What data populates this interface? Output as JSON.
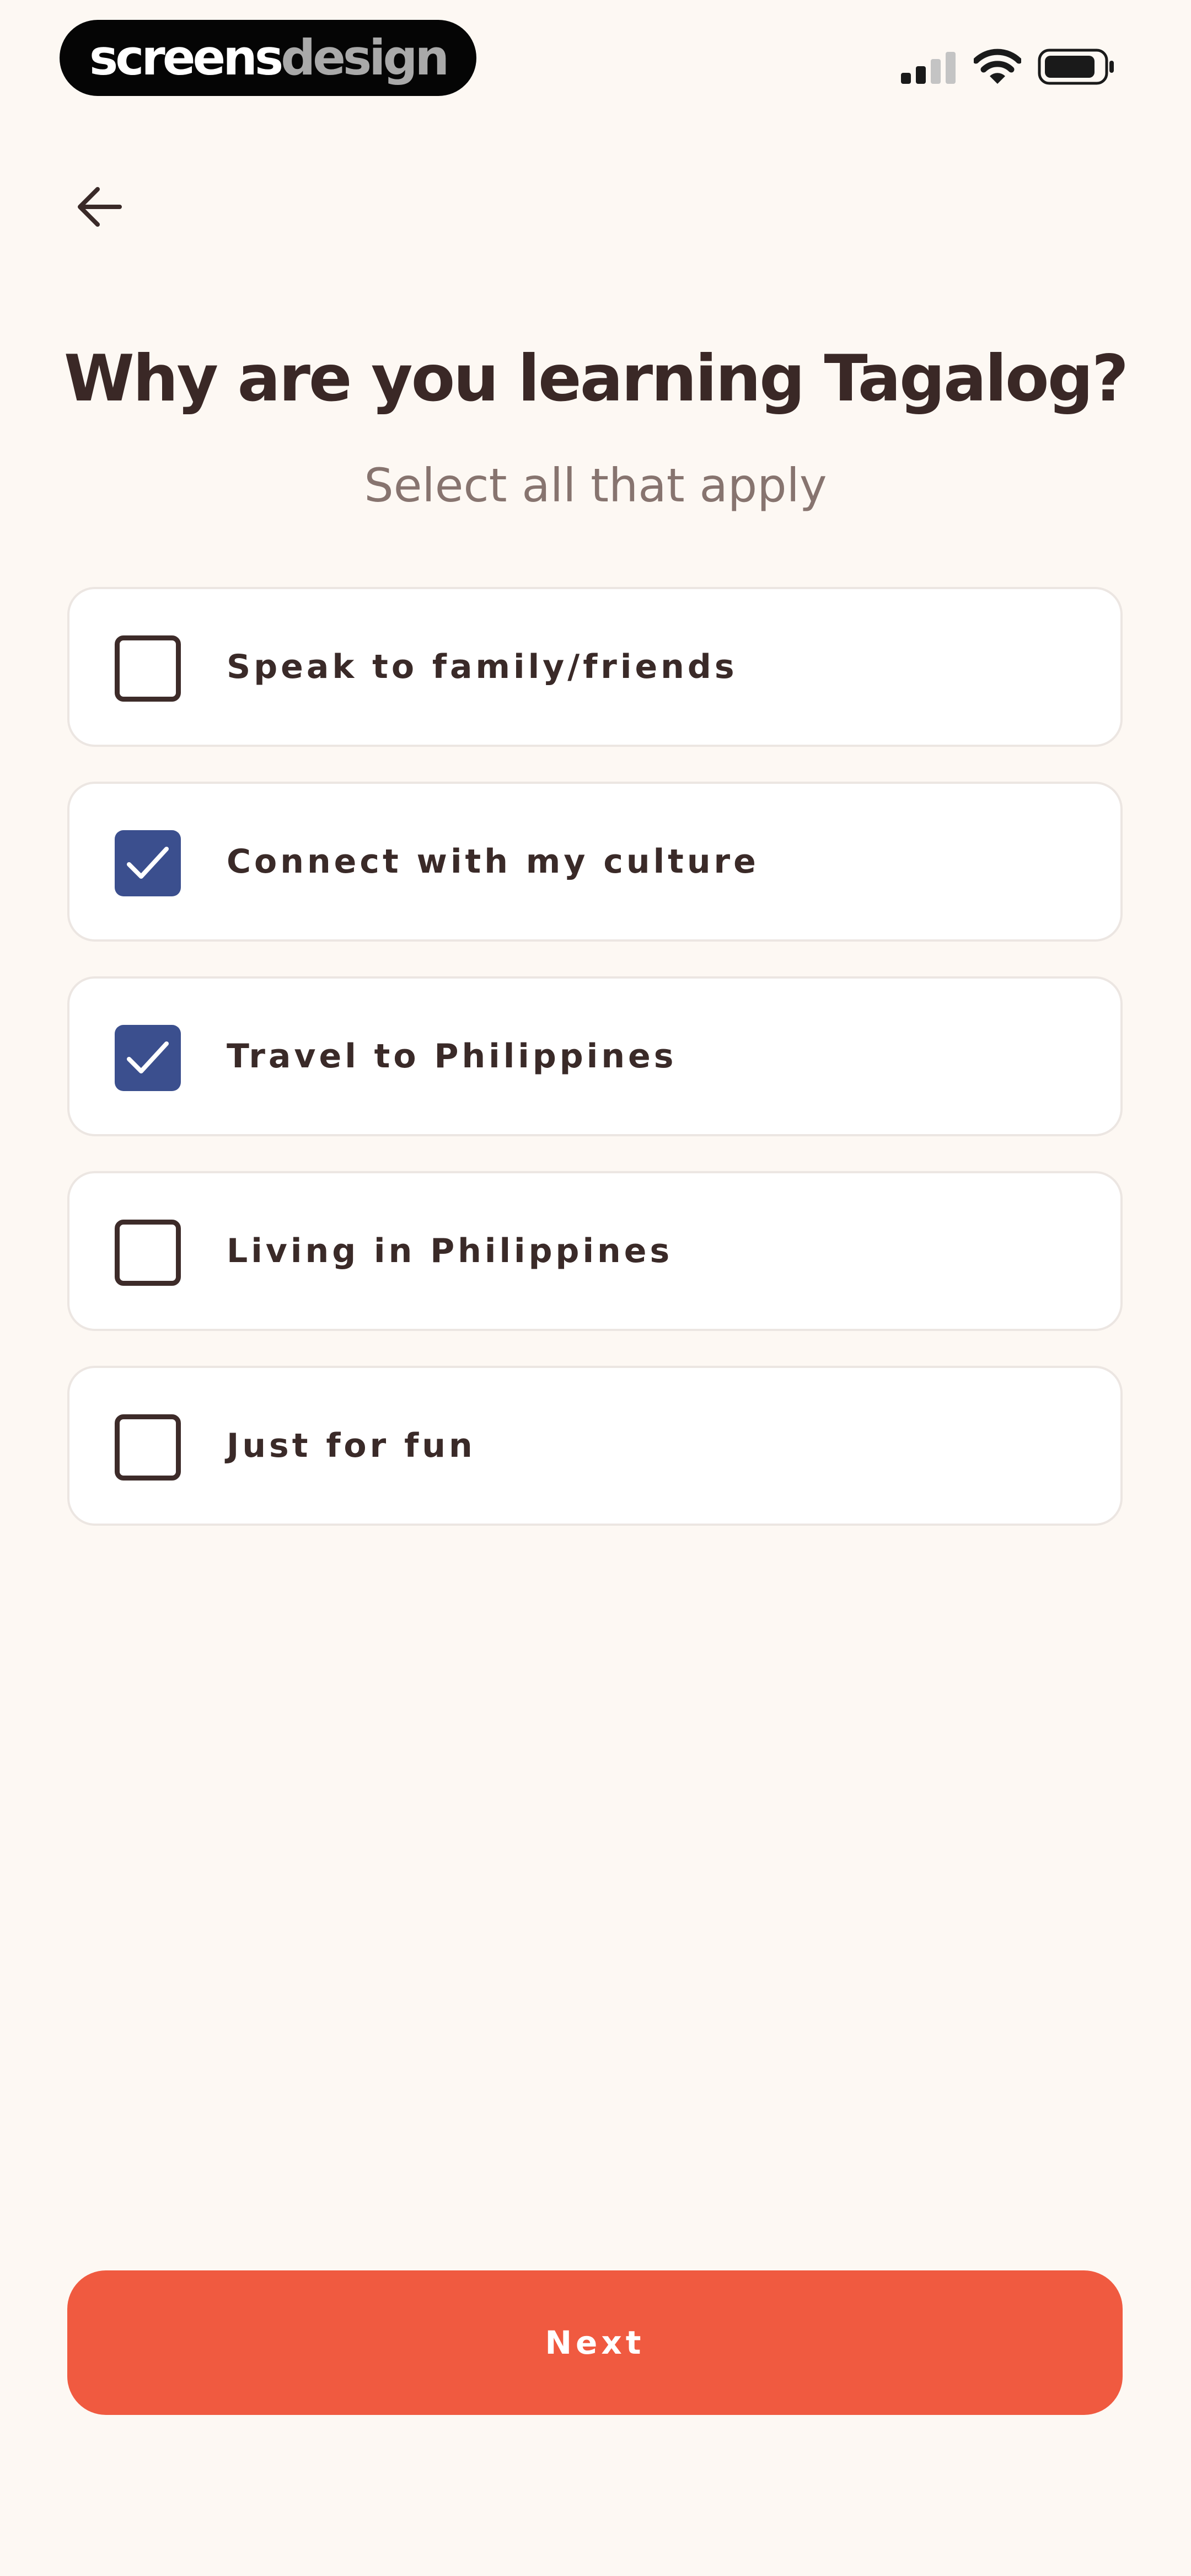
{
  "status_bar": {
    "brand_part1": "screens",
    "brand_part2": "design",
    "icons": [
      "cellular-signal-icon",
      "wifi-icon",
      "battery-icon"
    ]
  },
  "navigation": {
    "back_icon": "arrow-left-icon"
  },
  "question": {
    "title": "Why are you learning Tagalog?",
    "subtitle": "Select all that apply"
  },
  "options": [
    {
      "label": "Speak to family/friends",
      "checked": false
    },
    {
      "label": "Connect with my culture",
      "checked": true
    },
    {
      "label": "Travel to Philippines",
      "checked": true
    },
    {
      "label": "Living in Philippines",
      "checked": false
    },
    {
      "label": "Just for fun",
      "checked": false
    }
  ],
  "next_button": {
    "label": "Next"
  },
  "colors": {
    "background": "#fdf8f3",
    "accent": "#f05a40",
    "checkbox_checked": "#3b4f8e",
    "text": "#3a2a28",
    "subtitle": "#87746f"
  }
}
